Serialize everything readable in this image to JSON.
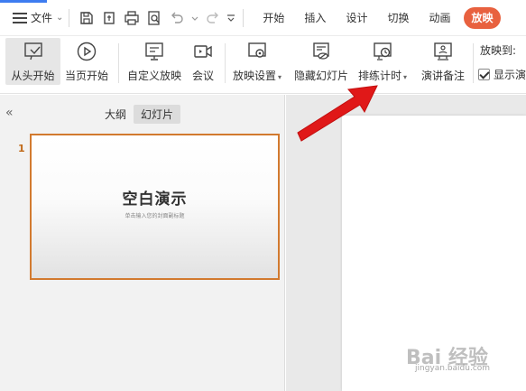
{
  "menubar": {
    "file_label": "文件",
    "tabs": [
      "开始",
      "插入",
      "设计",
      "切换",
      "动画",
      "放映"
    ],
    "active_tab": "放映"
  },
  "ribbon": {
    "from_start": "从头开始",
    "from_current": "当页开始",
    "custom_show": "自定义放映",
    "meeting": "会议",
    "show_settings": "放映设置",
    "hide_slide": "隐藏幻灯片",
    "rehearse_timing": "排练计时",
    "speaker_notes": "演讲备注",
    "play_to": "放映到:",
    "show_checkbox": "显示演"
  },
  "left_panel": {
    "view_tabs": [
      "大纲",
      "幻灯片"
    ],
    "active_view": "幻灯片",
    "slide_number": "1",
    "slide_title": "空白演示",
    "slide_subtitle": "单击输入您的封面副标题"
  },
  "watermark": {
    "text": "Bai 经验",
    "url": "jingyan.baidu.com"
  },
  "colors": {
    "accent_tab": "#e8613f",
    "slide_border": "#d27a2f",
    "annotation_arrow": "#e01818",
    "accent_strip": "#3d7cf0"
  }
}
